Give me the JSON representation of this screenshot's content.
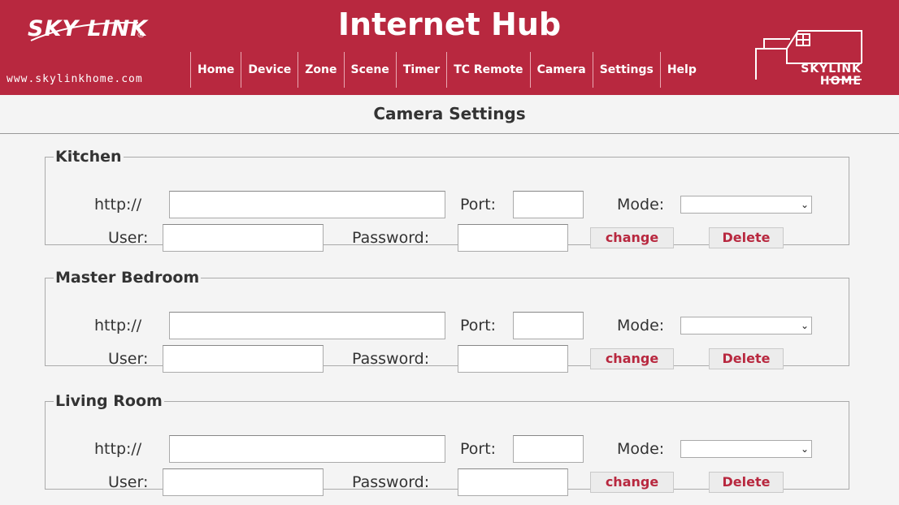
{
  "header": {
    "logo_text": "SKY LINK",
    "logo_registered": "®",
    "url": "www.skylinkhome.com",
    "title": "Internet Hub",
    "brand_line1": "SKYLINK",
    "brand_line2": "HOME"
  },
  "nav": [
    {
      "label": "Home"
    },
    {
      "label": "Device"
    },
    {
      "label": "Zone"
    },
    {
      "label": "Scene"
    },
    {
      "label": "Timer"
    },
    {
      "label": "TC Remote"
    },
    {
      "label": "Camera"
    },
    {
      "label": "Settings"
    },
    {
      "label": "Help"
    }
  ],
  "page_title": "Camera Settings",
  "labels": {
    "http": "http://",
    "port": "Port:",
    "mode": "Mode:",
    "user": "User:",
    "password": "Password:",
    "change": "change",
    "delete": "Delete"
  },
  "cameras": [
    {
      "name": "Kitchen",
      "url": "",
      "port": "",
      "mode": "",
      "user": "",
      "password": ""
    },
    {
      "name": "Master Bedroom",
      "url": "",
      "port": "",
      "mode": "",
      "user": "",
      "password": ""
    },
    {
      "name": "Living Room",
      "url": "",
      "port": "",
      "mode": "",
      "user": "",
      "password": ""
    }
  ],
  "colors": {
    "brand_red": "#b8283f",
    "background": "#f4f4f4"
  }
}
